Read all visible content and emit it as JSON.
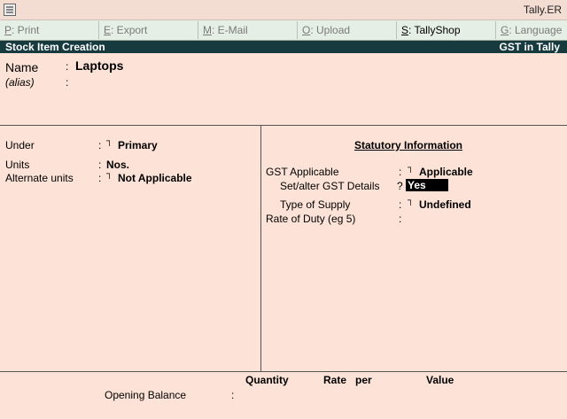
{
  "window": {
    "title": "Tally.ER"
  },
  "toolbar": [
    {
      "key": "P",
      "rest": ": Print",
      "active": false
    },
    {
      "key": "E",
      "rest": ": Export",
      "active": false
    },
    {
      "key": "M",
      "rest": ": E-Mail",
      "active": false
    },
    {
      "key": "O",
      "rest": ": Upload",
      "active": false
    },
    {
      "key": "S",
      "rest": ": TallyShop",
      "active": true
    },
    {
      "key": "G",
      "rest": ": Language",
      "active": false
    }
  ],
  "header": {
    "title": "Stock Item Creation",
    "right": "GST in Tally"
  },
  "name": {
    "label": "Name",
    "sep": ":",
    "value": "Laptops"
  },
  "alias": {
    "label": "(alias)",
    "sep": ":"
  },
  "under": {
    "label": "Under",
    "sep": ":",
    "bullet": "┐",
    "value": "Primary"
  },
  "units": {
    "label": "Units",
    "sep": ":",
    "value": "Nos."
  },
  "alt_units": {
    "label": "Alternate units",
    "sep": ":",
    "bullet": "┐",
    "value": "Not Applicable"
  },
  "statutory": {
    "title": "Statutory Information",
    "gst_applicable": {
      "label": "GST Applicable",
      "sep": ":",
      "bullet": "┐",
      "value": "Applicable"
    },
    "set_alter": {
      "label": "Set/alter GST Details",
      "sep": "?",
      "value": "Yes"
    },
    "supply_type": {
      "label": "Type of Supply",
      "sep": ":",
      "bullet": "┐",
      "value": "Undefined"
    },
    "rate_duty": {
      "label": "Rate of Duty (eg 5)",
      "sep": ":"
    }
  },
  "opening": {
    "col_quantity": "Quantity",
    "col_rate": "Rate",
    "col_per": "per",
    "col_value": "Value",
    "label": "Opening Balance",
    "sep": ":"
  }
}
